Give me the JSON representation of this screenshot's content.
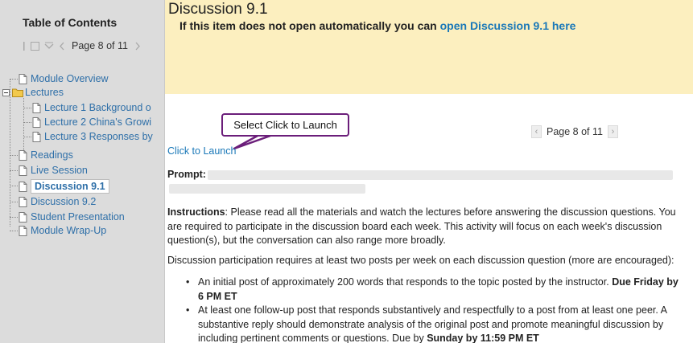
{
  "toc": {
    "title": "Table of Contents",
    "page_indicator": "Page 8 of 11",
    "items": [
      {
        "label": "Module Overview",
        "icon": "page-icon"
      },
      {
        "label": "Lectures",
        "icon": "folder-icon"
      },
      {
        "label": "Lecture 1 Background o",
        "icon": "page-icon"
      },
      {
        "label": "Lecture 2 China's Growi",
        "icon": "page-icon"
      },
      {
        "label": "Lecture 3 Responses by",
        "icon": "page-icon"
      },
      {
        "label": "Readings",
        "icon": "page-icon"
      },
      {
        "label": "Live Session",
        "icon": "page-icon"
      },
      {
        "label": "Discussion 9.1",
        "icon": "page-icon"
      },
      {
        "label": "Discussion 9.2",
        "icon": "page-icon"
      },
      {
        "label": "Student Presentation",
        "icon": "page-icon"
      },
      {
        "label": "Module Wrap-Up",
        "icon": "page-icon"
      }
    ]
  },
  "header": {
    "title": "Discussion 9.1",
    "open_prefix": "If this item does not open automatically you can ",
    "open_link": "open Discussion 9.1 here"
  },
  "pager": {
    "label": "Page 8 of 11"
  },
  "callout": {
    "text": "Select Click to Launch"
  },
  "content": {
    "launch_link": "Click to Launch",
    "prompt_label": "Prompt:",
    "instructions_label": "Instructions",
    "instructions_text": ":  Please read all the materials and watch the lectures before answering the discussion questions. You are required to participate in the discussion board each week. This activity will focus on each week's discussion question(s), but the conversation can also range more broadly.",
    "participation_text": "Discussion participation requires at least two posts per week on each discussion question (more are encouraged):",
    "bullets": [
      {
        "text": "An initial post of approximately 200 words that responds to the topic posted by the instructor. ",
        "bold": "Due Friday by 6 PM ET"
      },
      {
        "text": "At least one follow-up post that responds substantively and respectfully to a post from at least one peer. A substantive reply should demonstrate analysis of the original post and promote meaningful discussion by including pertinent comments or questions. Due by ",
        "bold": "Sunday by 11:59 PM ET"
      }
    ]
  },
  "colors": {
    "header_bg": "#fcefbf",
    "sidebar_bg": "#dcdcdc",
    "link": "#1a78b8",
    "callout_border": "#6b1e7a"
  }
}
